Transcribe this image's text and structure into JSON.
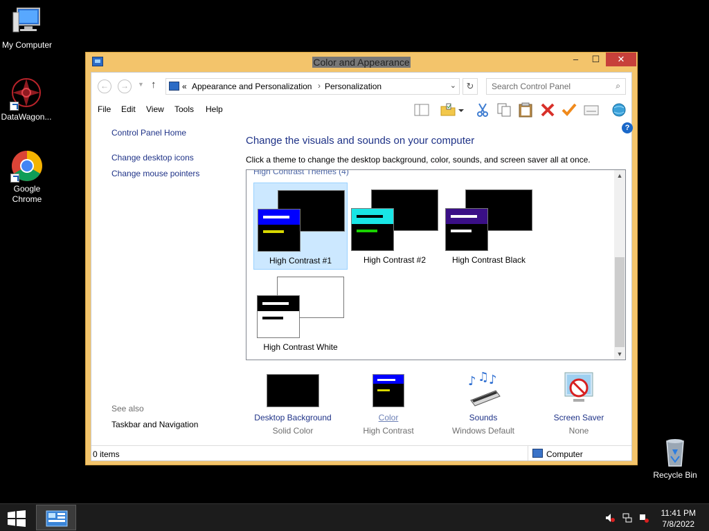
{
  "desktop": {
    "icons": [
      {
        "label": "My Computer"
      },
      {
        "label": "DataWagon..."
      },
      {
        "label": "Google Chrome"
      },
      {
        "label": "Recycle Bin"
      }
    ]
  },
  "window": {
    "title": "Color and Appearance",
    "controls": {
      "minimize": "–",
      "maximize": "☐",
      "close": "✕"
    },
    "address": {
      "prefix": "«",
      "segments": [
        "Appearance and Personalization",
        "Personalization"
      ],
      "separator": "›"
    },
    "search": {
      "placeholder": "Search Control Panel"
    },
    "menu": [
      "File",
      "Edit",
      "View",
      "Tools",
      "Help"
    ],
    "left_pane": {
      "home": "Control Panel Home",
      "links": [
        "Change desktop icons",
        "Change mouse pointers"
      ],
      "see_also_heading": "See also",
      "see_also_links": [
        "Taskbar and Navigation"
      ]
    },
    "main": {
      "heading": "Change the visuals and sounds on your computer",
      "description": "Click a theme to change the desktop background, color, sounds, and screen saver all at once.",
      "group_title": "High Contrast Themes (4)",
      "themes": [
        {
          "name": "High Contrast #1",
          "selected": true,
          "bar_color": "#0000ff",
          "line1_color": "#ffffff",
          "line2_color": "#d8d800",
          "bg_color": "#000000"
        },
        {
          "name": "High Contrast #2",
          "selected": false,
          "bar_color": "#19e6e6",
          "line1_color": "#000000",
          "line2_color": "#19d100",
          "bg_color": "#000000"
        },
        {
          "name": "High Contrast Black",
          "selected": false,
          "bar_color": "#3a0f86",
          "line1_color": "#ffffff",
          "line2_color": "#ffffff",
          "bg_color": "#000000"
        },
        {
          "name": "High Contrast White",
          "selected": false,
          "bar_color": "#000000",
          "line1_color": "#ffffff",
          "line2_color": "#000000",
          "bg_color": "#ffffff"
        }
      ],
      "settings": [
        {
          "label": "Desktop Background",
          "value": "Solid Color"
        },
        {
          "label": "Color",
          "value": "High Contrast"
        },
        {
          "label": "Sounds",
          "value": "Windows Default"
        },
        {
          "label": "Screen Saver",
          "value": "None"
        }
      ]
    },
    "status": {
      "items": "0 items",
      "location": "Computer"
    }
  },
  "taskbar": {
    "time": "11:41 PM",
    "date": "7/8/2022"
  },
  "colors": {
    "window_frame": "#f3c46b",
    "close_button": "#c7403a",
    "link": "#1e3287",
    "selection": "#cce8ff"
  }
}
